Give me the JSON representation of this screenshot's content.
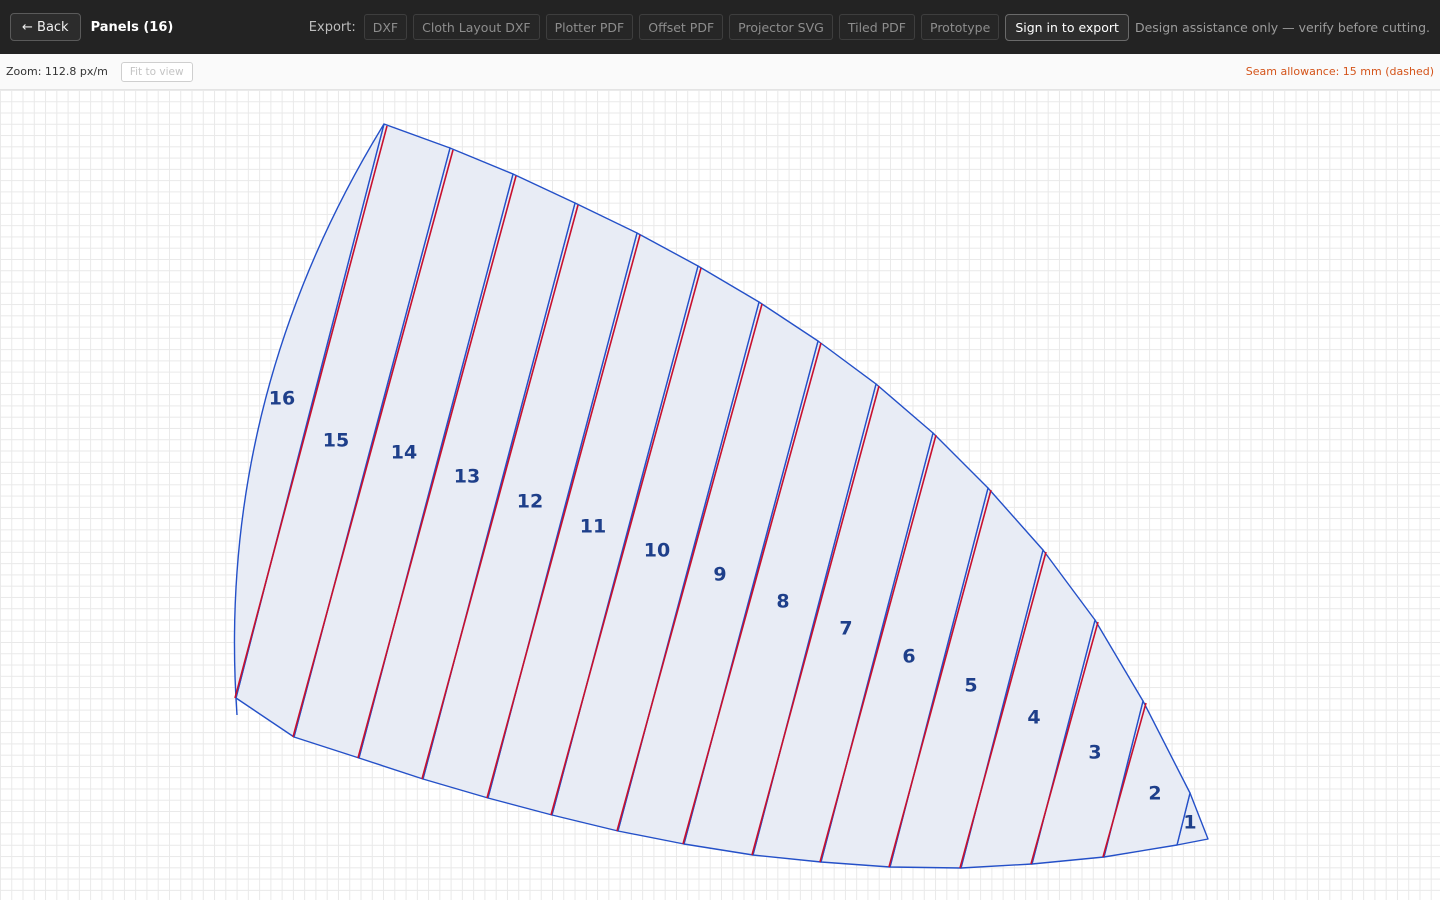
{
  "header": {
    "back_label": "← Back",
    "title": "Panels (16)",
    "export_label": "Export:",
    "export_buttons": [
      "DXF",
      "Cloth Layout DXF",
      "Plotter PDF",
      "Offset PDF",
      "Projector SVG",
      "Tiled PDF",
      "Prototype"
    ],
    "sign_in_label": "Sign in to export",
    "disclaimer": "Design assistance only — verify before cutting."
  },
  "toolbar": {
    "zoom_label": "Zoom: 112.8 px/m",
    "fit_label": "Fit to view",
    "seam_label": "Seam allowance: 15 mm (dashed)"
  },
  "panels": {
    "count": 16,
    "labels": [
      "1",
      "2",
      "3",
      "4",
      "5",
      "6",
      "7",
      "8",
      "9",
      "10",
      "11",
      "12",
      "13",
      "14",
      "15",
      "16"
    ]
  },
  "colors": {
    "panel_fill": "#e8ecf5",
    "panel_outline": "#2450c8",
    "seam_line": "#c8102e",
    "label": "#1e3f8a",
    "seam_text": "#d4541a"
  }
}
